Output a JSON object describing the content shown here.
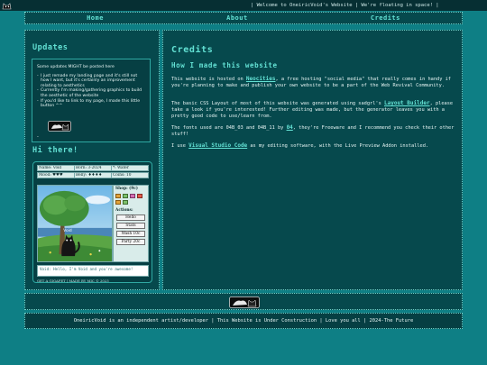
{
  "topbar": {
    "marquee": "| Welcome to OneiricVoid's Website | We're floating in space! |"
  },
  "nav": {
    "items": [
      "Home",
      "About",
      "Credits"
    ]
  },
  "sidebar": {
    "updates_title": "Updates",
    "updates_intro": "Some updates MIGHT be posted here",
    "updates_items": [
      "I just remade my landing page and it's still not how I want, but it's certainly an improvement relating to aesthetics",
      "Currently I'm making/gathering graphics to build the aesthetic of the website",
      "If you'd like to link to my page, I made this little button ^^"
    ],
    "hi_title": "Hi there!",
    "pet": {
      "row1": [
        "Name: Void",
        "Born: 3-2024",
        "*: Water"
      ],
      "row2": [
        "Mood: ♥♥♥",
        "Belly: ♦♦♦♦",
        "Coins: 10"
      ],
      "scene_name": "Void",
      "shop_label": "Shop: (9c)",
      "actions_label": "Actions:",
      "actions": [
        "Hello",
        "Stats",
        "Wash 10c",
        "Party 20c"
      ],
      "speech": "Void: Hello, I'm Void and you're awesome!",
      "credit": "GET A GIGAPET | MADE BY MIC © 2023"
    }
  },
  "main": {
    "title": "Credits",
    "subtitle": "How I made this website",
    "p1_before": "This website is hosted on ",
    "p1_link": "Neocities",
    "p1_after": ", a free hosting \"social media\" that really comes in handy if you're planning to make and publish your own website to be a part of the Web Revival Community.",
    "p2_before": "The basic CSS Layout of most of this website was generated using sadgrl's ",
    "p2_link": "Layout Builder",
    "p2_after": ", please take a look if you're interested! Further editing was made, but the generator leaves you with a pretty good code to use/learn from.",
    "p3_before": "The fonts used are 04B_03 and 04B_11 by ",
    "p3_link": "04",
    "p3_after": ", they're Freeware and I recommend you check their other stuff!",
    "p4_before": "I use ",
    "p4_link": "Visual Studio Code",
    "p4_after": " as my editing software, with the Live Preview Addon installed."
  },
  "footer": {
    "text": "OneiricVoid is an independent artist/developer | This Website is Under Construction | Love you all | 2024-The Future"
  },
  "colors": {
    "background": "#0e7f85",
    "panel": "#06494d",
    "accent": "#63e1d4",
    "topbar": "#062f33"
  }
}
